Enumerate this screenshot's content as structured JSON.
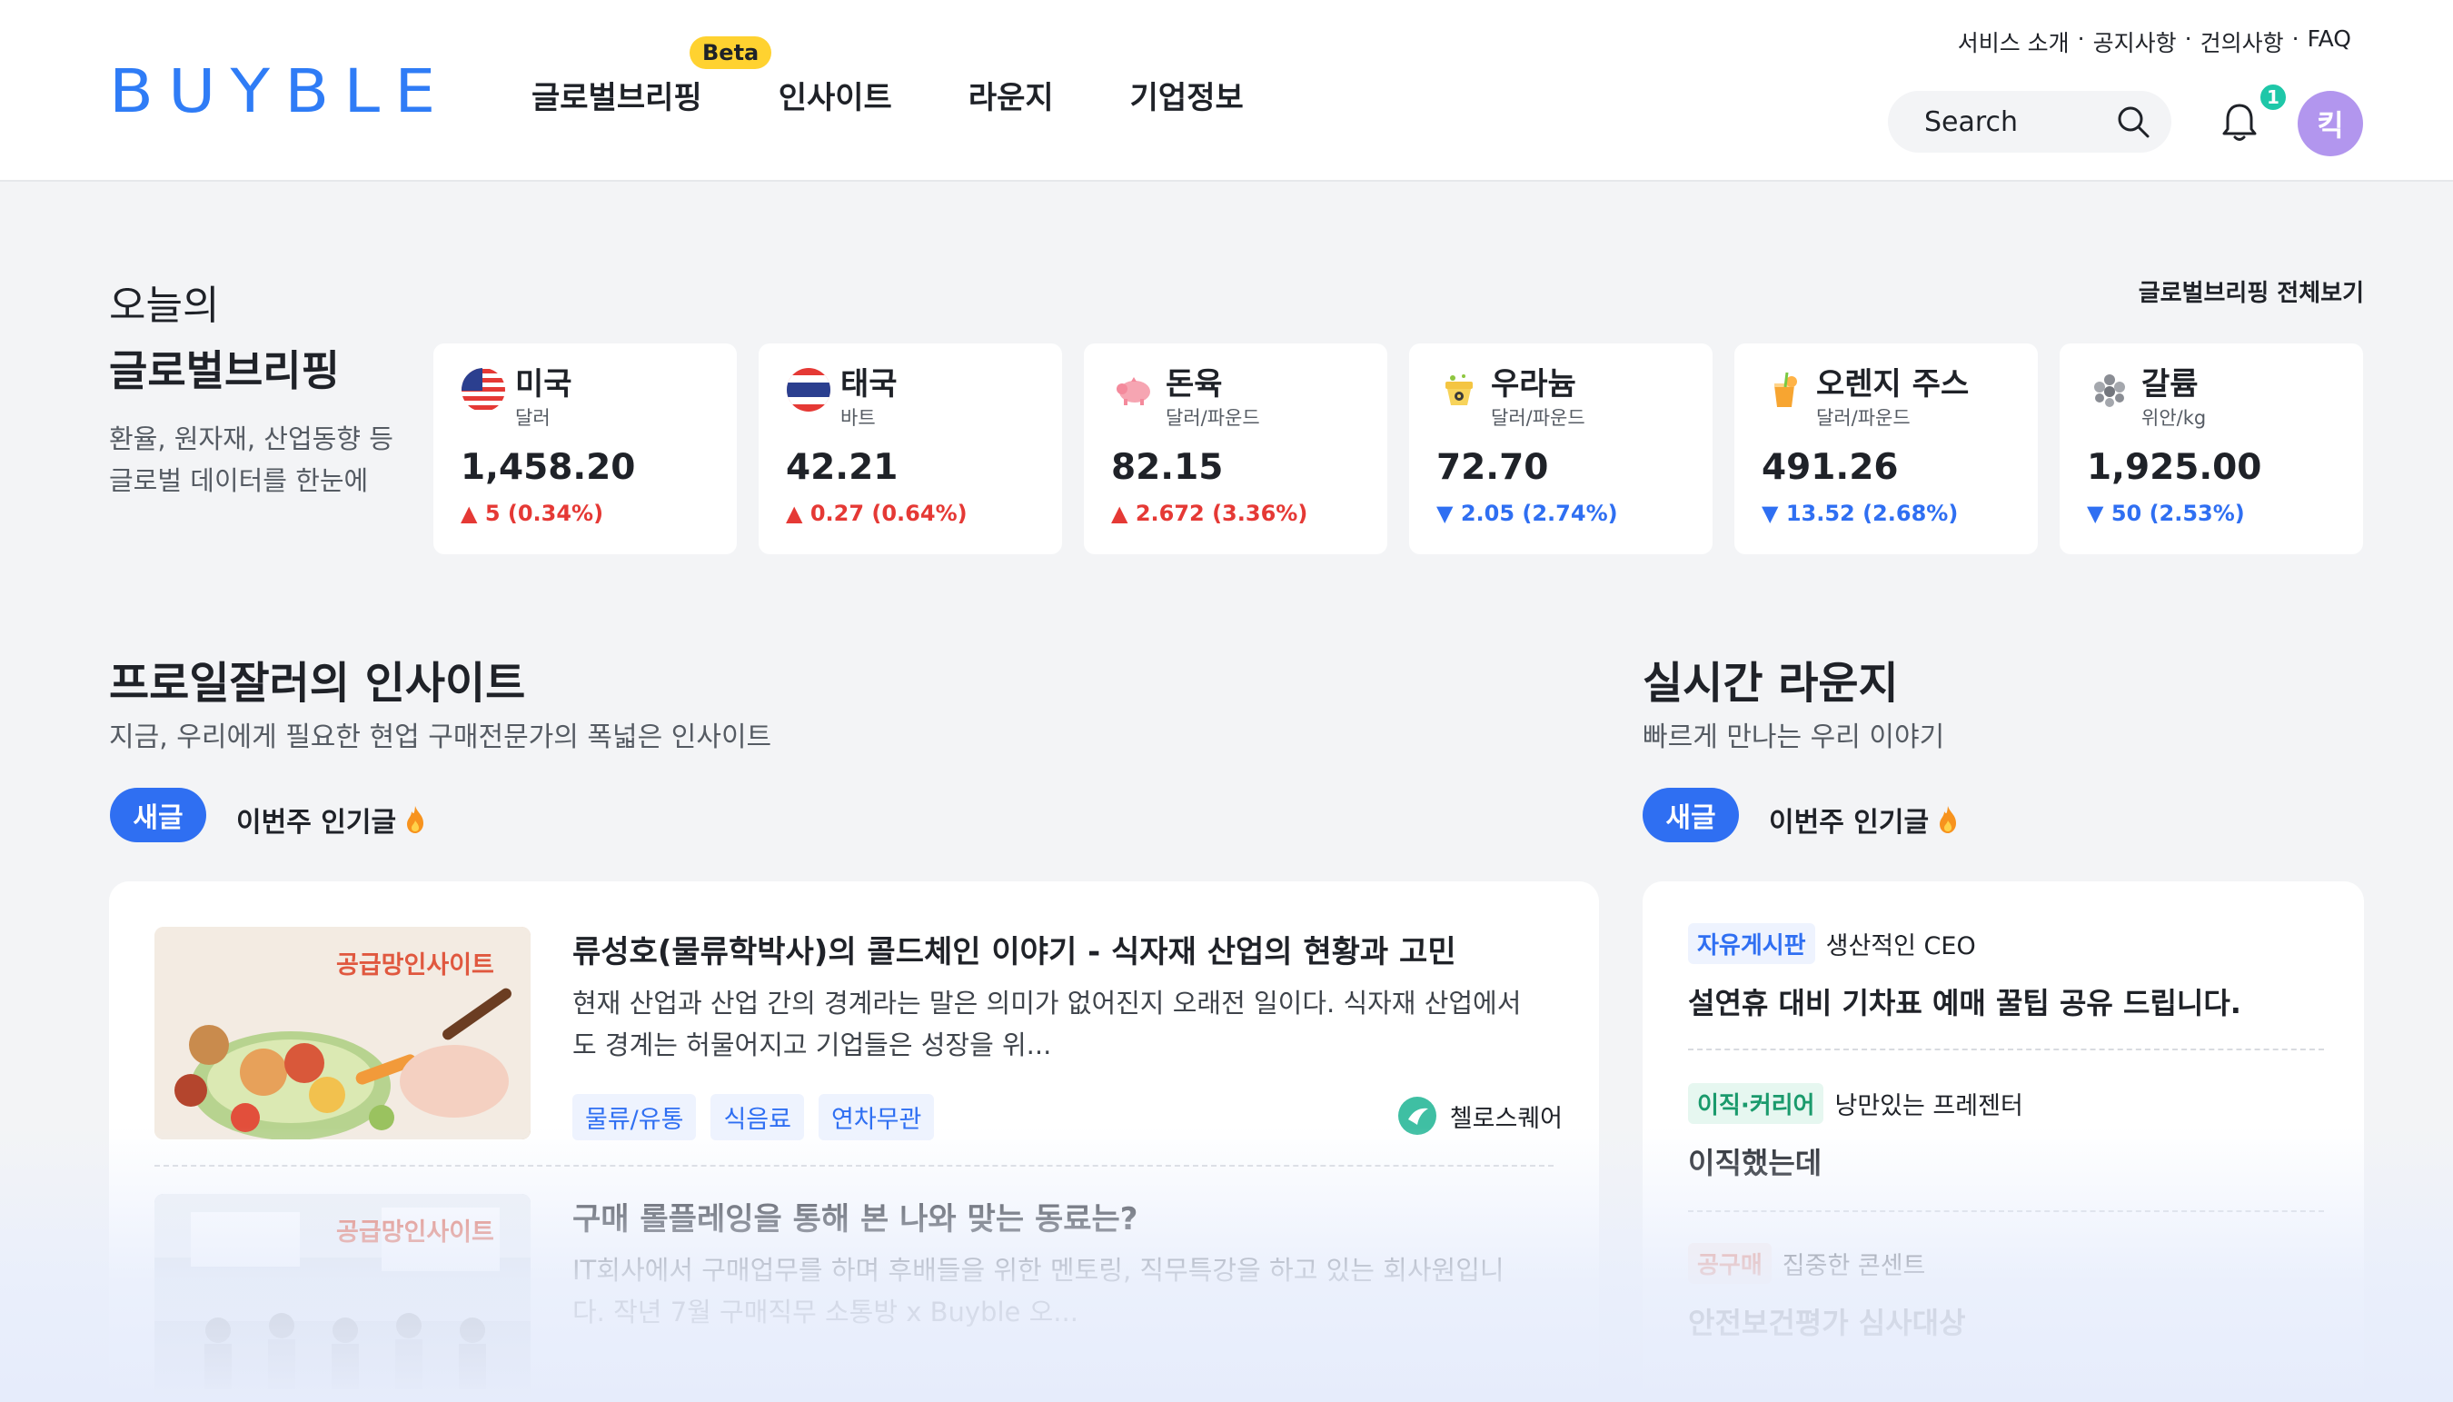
{
  "header": {
    "logo": "BUYBLE",
    "nav": [
      {
        "label": "글로벌브리핑",
        "badge": "Beta"
      },
      {
        "label": "인사이트"
      },
      {
        "label": "라운지"
      },
      {
        "label": "기업정보"
      }
    ],
    "util_links": [
      "서비스 소개",
      "공지사항",
      "건의사항",
      "FAQ"
    ],
    "search_placeholder": "Search",
    "notification_count": "1",
    "avatar_initial": "킥"
  },
  "briefing": {
    "title_line1": "오늘의",
    "title_line2": "글로벌브리핑",
    "subtitle": "환율, 원자재, 산업동향 등 글로벌 데이터를 한눈에",
    "view_all": "글로벌브리핑 전체보기",
    "cards": [
      {
        "name": "미국",
        "unit": "달러",
        "value": "1,458.20",
        "change": "5 (0.34%)",
        "direction": "up",
        "icon": "us-flag-icon"
      },
      {
        "name": "태국",
        "unit": "바트",
        "value": "42.21",
        "change": "0.27 (0.64%)",
        "direction": "up",
        "icon": "thailand-flag-icon"
      },
      {
        "name": "돈육",
        "unit": "달러/파운드",
        "value": "82.15",
        "change": "2.672 (3.36%)",
        "direction": "up",
        "icon": "pig-icon"
      },
      {
        "name": "우라늄",
        "unit": "달러/파운드",
        "value": "72.70",
        "change": "2.05 (2.74%)",
        "direction": "down",
        "icon": "uranium-icon"
      },
      {
        "name": "오렌지 주스",
        "unit": "달러/파운드",
        "value": "491.26",
        "change": "13.52 (2.68%)",
        "direction": "down",
        "icon": "orange-juice-icon"
      },
      {
        "name": "갈륨",
        "unit": "위안/kg",
        "value": "1,925.00",
        "change": "50 (2.53%)",
        "direction": "down",
        "icon": "gallium-icon"
      }
    ],
    "colors": {
      "up": "#e53935",
      "down": "#2f6ff2"
    }
  },
  "insight": {
    "title": "프로일잘러의 인사이트",
    "subtitle": "지금, 우리에게 필요한 현업 구매전문가의 폭넓은 인사이트",
    "tab_new": "새글",
    "tab_popular": "이번주 인기글",
    "posts": [
      {
        "thumb_label": "공급망인사이트",
        "title": "류성호(물류학박사)의 콜드체인 이야기 - 식자재 산업의 현황과 고민",
        "desc": "현재 산업과 산업 간의 경계라는 말은 의미가 없어진지 오래전 일이다. 식자재 산업에서도 경계는 허물어지고 기업들은 성장을 위...",
        "tags": [
          "물류/유통",
          "식음료",
          "연차무관"
        ],
        "author": "첼로스퀘어"
      },
      {
        "thumb_label": "공급망인사이트",
        "title": "구매 롤플레잉을 통해 본 나와 맞는 동료는?",
        "desc": "IT회사에서 구매업무를 하며 후배들을 위한 멘토링, 직무특강을 하고 있는 회사원입니다. 작년 7월 구매직무 소통방 x Buyble 오..."
      }
    ]
  },
  "lounge": {
    "title": "실시간 라운지",
    "subtitle": "빠르게 만나는 우리 이야기",
    "tab_new": "새글",
    "tab_popular": "이번주 인기글",
    "items": [
      {
        "category": "자유게시판",
        "author": "생산적인 CEO",
        "title": "설연휴 대비 기차표 예매 꿀팁 공유 드립니다."
      },
      {
        "category": "이직·커리어",
        "author": "낭만있는 프레젠터",
        "title": "이직했는데"
      },
      {
        "category": "공구매",
        "author": "집중한 콘센트",
        "title": "안전보건평가 심사대상"
      }
    ]
  }
}
